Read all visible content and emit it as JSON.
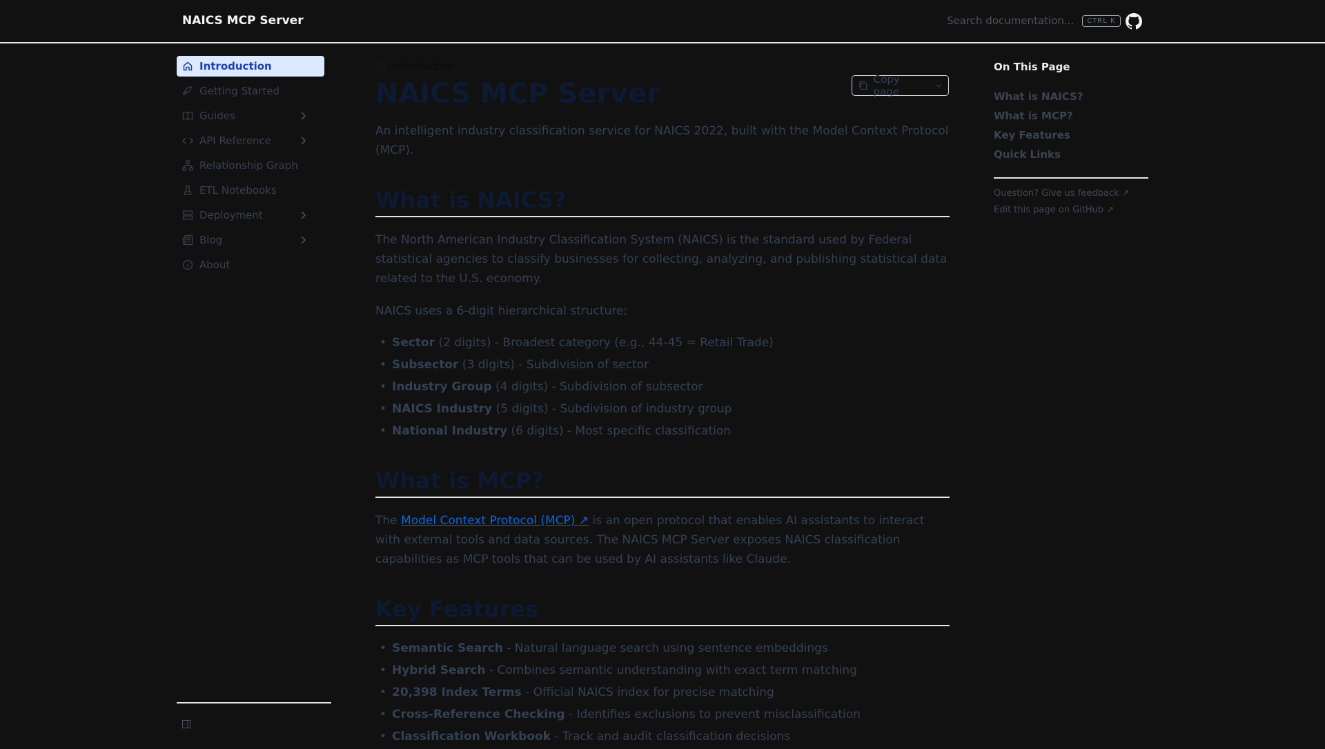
{
  "header": {
    "title": "NAICS MCP Server",
    "search_placeholder": "Search documentation...",
    "shortcut": "CTRL K"
  },
  "sidebar": {
    "items": [
      {
        "label": "Introduction",
        "icon": "home-icon",
        "active": true
      },
      {
        "label": "Getting Started",
        "icon": "rocket-icon"
      },
      {
        "label": "Guides",
        "icon": "book-icon",
        "expandable": true
      },
      {
        "label": "API Reference",
        "icon": "code-icon",
        "expandable": true
      },
      {
        "label": "Relationship Graph",
        "icon": "network-icon"
      },
      {
        "label": "ETL Notebooks",
        "icon": "flask-icon"
      },
      {
        "label": "Deployment",
        "icon": "server-icon",
        "expandable": true
      },
      {
        "label": "Blog",
        "icon": "newspaper-icon",
        "expandable": true
      },
      {
        "label": "About",
        "icon": "info-icon"
      }
    ]
  },
  "breadcrumb": "Introduction",
  "copy_page": "Copy page",
  "main": {
    "title": "NAICS MCP Server",
    "lead": "An intelligent industry classification service for NAICS 2022, built with the Model Context Protocol (MCP).",
    "s1": {
      "heading": "What is NAICS?",
      "p1": "The North American Industry Classification System (NAICS) is the standard used by Federal statistical agencies to classify businesses for collecting, analyzing, and publishing statistical data related to the U.S. economy.",
      "p2": "NAICS uses a 6-digit hierarchical structure:",
      "items": [
        {
          "b": "Sector",
          "t": " (2 digits) - Broadest category (e.g., 44-45 = Retail Trade)"
        },
        {
          "b": "Subsector",
          "t": " (3 digits) - Subdivision of sector"
        },
        {
          "b": "Industry Group",
          "t": " (4 digits) - Subdivision of subsector"
        },
        {
          "b": "NAICS Industry",
          "t": " (5 digits) - Subdivision of industry group"
        },
        {
          "b": "National Industry",
          "t": " (6 digits) - Most specific classification"
        }
      ]
    },
    "s2": {
      "heading": "What is MCP?",
      "pre": "The ",
      "link": "Model Context Protocol (MCP)",
      "post": " is an open protocol that enables AI assistants to interact with external tools and data sources. The NAICS MCP Server exposes NAICS classification capabilities as MCP tools that can be used by AI assistants like Claude."
    },
    "s3": {
      "heading": "Key Features",
      "items": [
        {
          "b": "Semantic Search",
          "t": " - Natural language search using sentence embeddings"
        },
        {
          "b": "Hybrid Search",
          "t": " - Combines semantic understanding with exact term matching"
        },
        {
          "b": "20,398 Index Terms",
          "t": " - Official NAICS index for precise matching"
        },
        {
          "b": "Cross-Reference Checking",
          "t": " - Identifies exclusions to prevent misclassification"
        },
        {
          "b": "Classification Workbook",
          "t": " - Track and audit classification decisions"
        }
      ]
    }
  },
  "toc": {
    "title": "On This Page",
    "items": [
      "What is NAICS?",
      "What is MCP?",
      "Key Features",
      "Quick Links"
    ],
    "feedback": "Question? Give us feedback",
    "edit": "Edit this page on GitHub"
  }
}
